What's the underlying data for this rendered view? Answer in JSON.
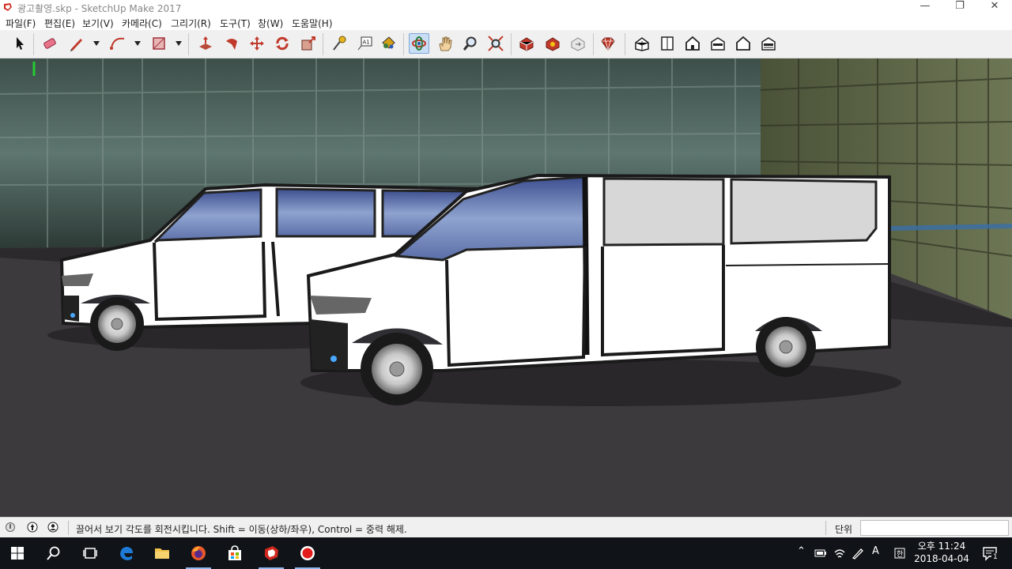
{
  "window": {
    "title": "광고촬영.skp - SketchUp Make 2017",
    "minimize_glyph": "—",
    "restore_glyph": "❐",
    "close_glyph": "✕"
  },
  "menu": [
    "파일(F)",
    "편집(E)",
    "보기(V)",
    "카메라(C)",
    "그리기(R)",
    "도구(T)",
    "창(W)",
    "도움말(H)"
  ],
  "toolbar": {
    "tools": [
      "select-tool",
      "eraser-tool",
      "line-tool",
      "arc-tool",
      "shape-tool",
      "push-pull-tool",
      "follow-me-tool",
      "move-tool",
      "rotate-tool",
      "scale-tool",
      "tape-measure-tool",
      "text-tool",
      "paint-bucket-tool",
      "orbit-tool",
      "pan-tool",
      "zoom-tool",
      "zoom-extents-tool",
      "warehouse-tool",
      "extension-warehouse-tool",
      "share-model-tool",
      "extension-manager-tool",
      "iso-view",
      "top-view",
      "front-view",
      "right-view",
      "back-view",
      "left-view"
    ],
    "active_tool": "orbit-tool",
    "text_tool_label": "A1"
  },
  "statusbar": {
    "hint": "끌어서 보기 각도를 회전시킵니다. Shift = 이동(상하/좌우), Control = 중력 해제.",
    "measure_label": "단위",
    "measure_value": ""
  },
  "taskbar": {
    "clock_time": "오후 11:24",
    "clock_date": "2018-04-04",
    "ime_label": "A",
    "notification_count": "1"
  },
  "colors": {
    "accent": "#c9def5",
    "taskbar": "#101418",
    "ground": "#3d3a3e"
  }
}
